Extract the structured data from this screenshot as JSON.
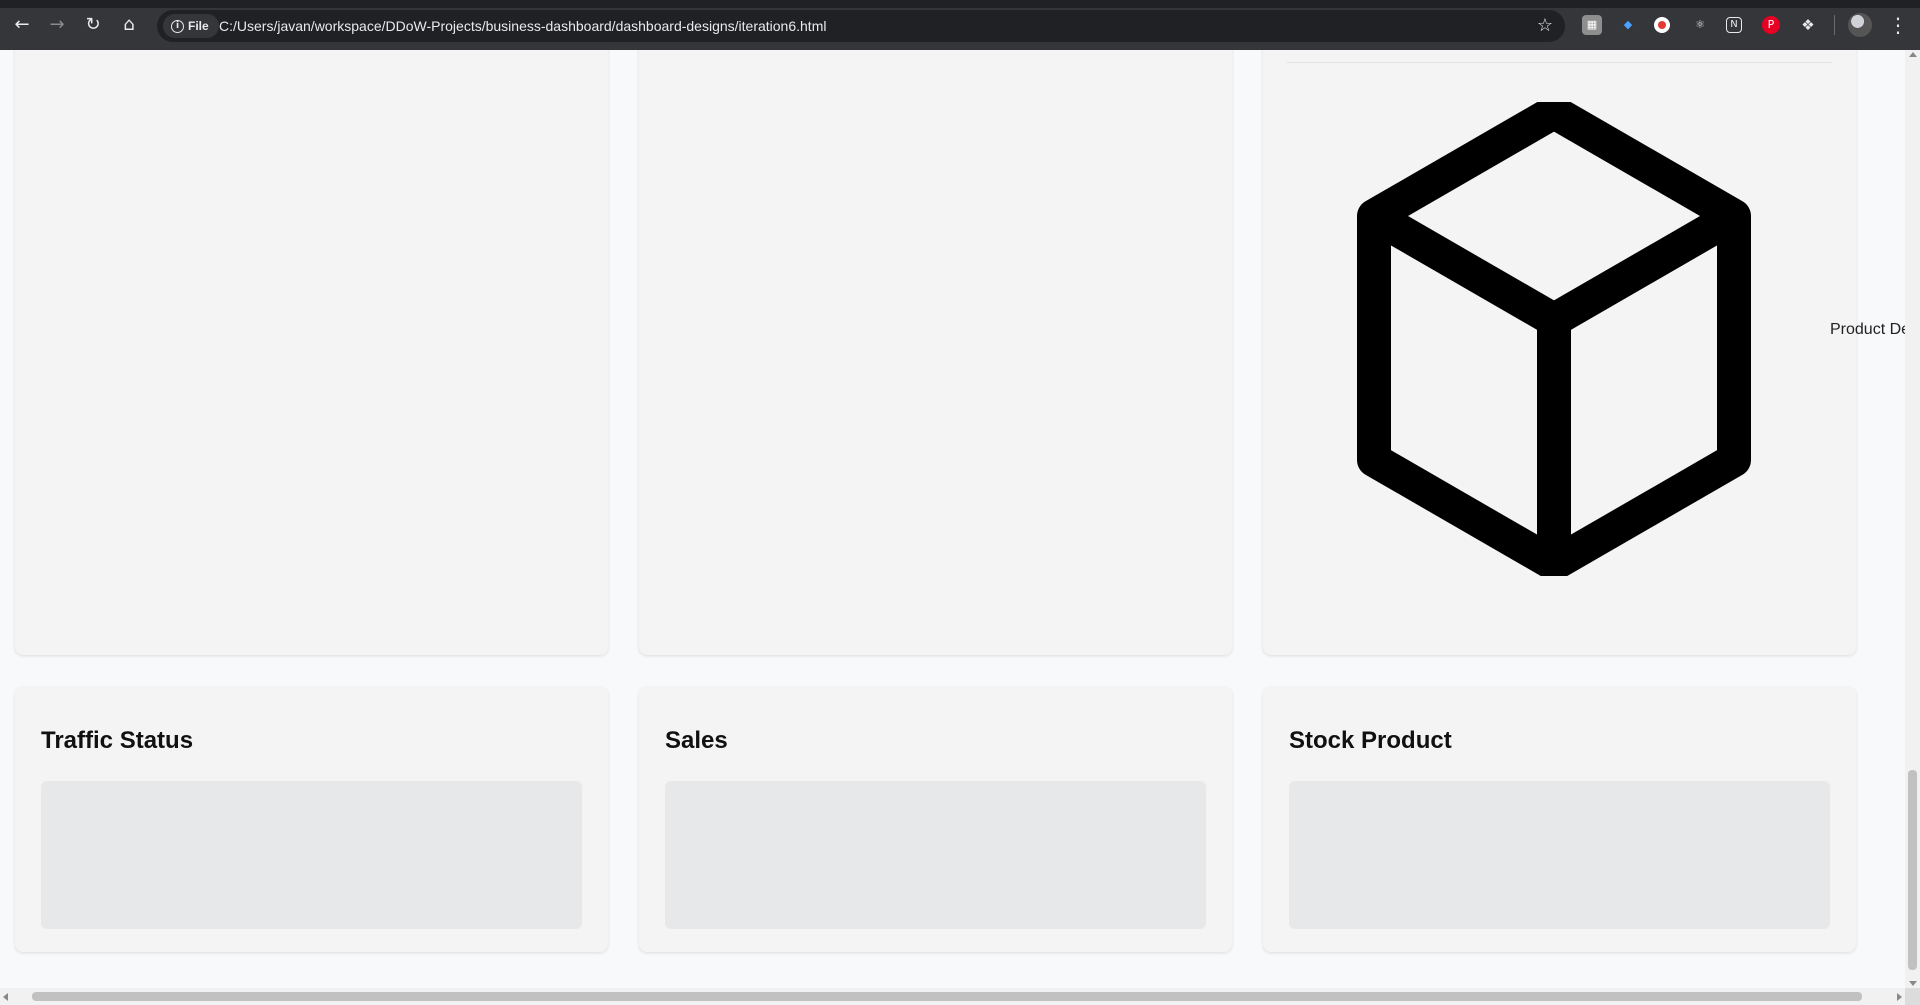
{
  "browser": {
    "file_chip_label": "File",
    "url": "C:/Users/javan/workspace/DDoW-Projects/business-dashboard/dashboard-designs/iteration6.html",
    "icons": [
      "back-icon",
      "forward-icon",
      "reload-icon",
      "home-icon",
      "info-icon",
      "bookmark-star-icon",
      "extensions-icon",
      "profile-avatar",
      "menu-icon"
    ]
  },
  "page": {
    "top_cards": {
      "right_card_label": "Product Developm"
    },
    "bottom_cards": [
      {
        "title": "Traffic Status"
      },
      {
        "title": "Sales"
      },
      {
        "title": "Stock Product"
      }
    ]
  },
  "colors": {
    "page_bg": "#f8f9fb",
    "card_bg": "#f4f4f4",
    "placeholder_bg": "#e6e8ea",
    "chrome_bg": "#35363a",
    "omnibox_bg": "#202124"
  }
}
